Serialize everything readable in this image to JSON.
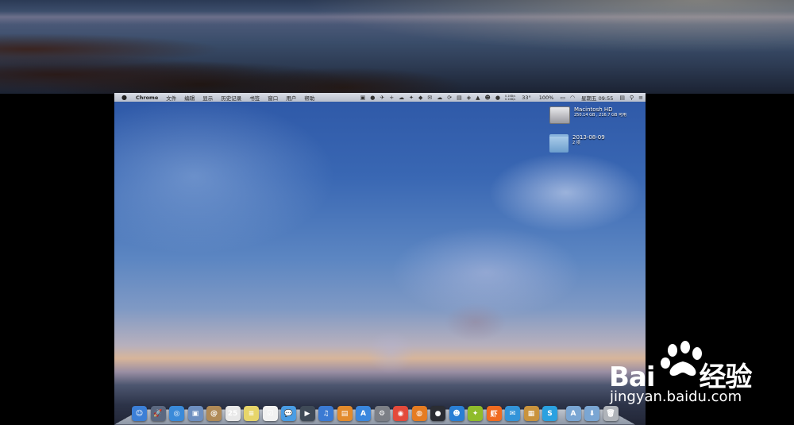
{
  "menubar": {
    "apple": "",
    "app": "Chrome",
    "items": [
      "文件",
      "编辑",
      "显示",
      "历史记录",
      "书签",
      "窗口",
      "用户",
      "帮助"
    ],
    "net_up": "0.1KB/s",
    "net_down": "0.1KB/s",
    "temp": "33°",
    "battery": "100%",
    "clock": "星期五 09:55"
  },
  "desktop": {
    "hd": {
      "name": "Macintosh HD",
      "info": "250.14 GB , 216.7 GB 可用"
    },
    "folder": {
      "name": "2013-08-09",
      "info": "2 项"
    }
  },
  "dock": {
    "apps": [
      {
        "name": "finder-icon",
        "glyph": "☺",
        "color": "#3c7fd6"
      },
      {
        "name": "launchpad-icon",
        "glyph": "🚀",
        "color": "#5b6880"
      },
      {
        "name": "safari-icon",
        "glyph": "◎",
        "color": "#3a8ad9"
      },
      {
        "name": "preview-icon",
        "glyph": "▣",
        "color": "#6e8fc0"
      },
      {
        "name": "contacts-icon",
        "glyph": "@",
        "color": "#b08a57"
      },
      {
        "name": "calendar-icon",
        "glyph": "25",
        "color": "#e8e8e8"
      },
      {
        "name": "notes-icon",
        "glyph": "≡",
        "color": "#e7d56a"
      },
      {
        "name": "reminders-icon",
        "glyph": "☑",
        "color": "#f1f1f1"
      },
      {
        "name": "messages-icon",
        "glyph": "💬",
        "color": "#4a9de4"
      },
      {
        "name": "facetime-icon",
        "glyph": "▶",
        "color": "#3f4a57"
      },
      {
        "name": "itunes-icon",
        "glyph": "♫",
        "color": "#3b7ad3"
      },
      {
        "name": "ibooks-icon",
        "glyph": "▤",
        "color": "#e38b2c"
      },
      {
        "name": "appstore-icon",
        "glyph": "A",
        "color": "#3a87de"
      },
      {
        "name": "system-prefs-icon",
        "glyph": "⚙",
        "color": "#7c7f86"
      },
      {
        "name": "chrome-icon",
        "glyph": "◉",
        "color": "#e34a3b"
      },
      {
        "name": "firefox-icon",
        "glyph": "◍",
        "color": "#e57c22"
      },
      {
        "name": "growl-icon",
        "glyph": "●",
        "color": "#2b2d33"
      },
      {
        "name": "qq-icon",
        "glyph": "☻",
        "color": "#2a7fd5"
      },
      {
        "name": "evernote-icon",
        "glyph": "✦",
        "color": "#8fbc2b"
      },
      {
        "name": "xiami-icon",
        "glyph": "虾",
        "color": "#f06b20"
      },
      {
        "name": "twitter-icon",
        "glyph": "✉",
        "color": "#3394d9"
      },
      {
        "name": "box-icon",
        "glyph": "▦",
        "color": "#c9933d"
      },
      {
        "name": "skype-icon",
        "glyph": "S",
        "color": "#2ba1e0"
      }
    ],
    "stacks": [
      {
        "name": "applications-stack-icon",
        "glyph": "A",
        "color": "#7aa6d3"
      },
      {
        "name": "downloads-stack-icon",
        "glyph": "⬇",
        "color": "#7aa6d3"
      },
      {
        "name": "trash-icon",
        "glyph": "🗑",
        "color": "#b0b4ba"
      }
    ]
  },
  "watermark": {
    "brand": "Bai",
    "brand2": "经验",
    "url": "jingyan.baidu.com"
  }
}
